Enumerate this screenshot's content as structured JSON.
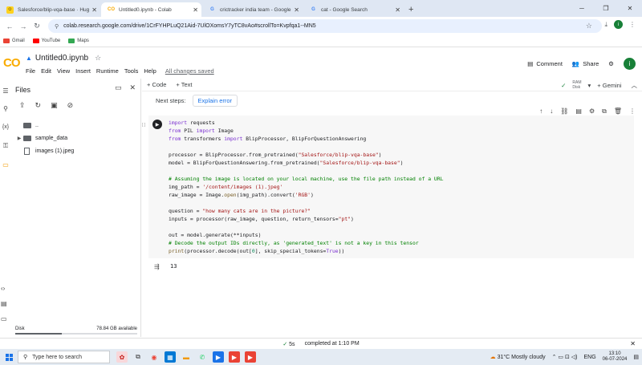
{
  "browser": {
    "tabs": [
      {
        "title": "Salesforce/blip-vqa-base · Hug",
        "icon": "huggingface-icon",
        "active": false
      },
      {
        "title": "Untitled0.ipynb - Colab",
        "icon": "colab-icon",
        "active": true
      },
      {
        "title": "crictracker india team - Google",
        "icon": "google-icon",
        "active": false
      },
      {
        "title": "cat - Google Search",
        "icon": "google-icon",
        "active": false
      }
    ],
    "url": "colab.research.google.com/drive/1CrFYHPLuQ21Aid-7UlOXomsY7yTC8vAo#scrollTo=Kvpfqa1--MN5",
    "bookmarks": [
      {
        "label": "Gmail",
        "color": "#ea4335"
      },
      {
        "label": "YouTube",
        "color": "#ff0000"
      },
      {
        "label": "Maps",
        "color": "#34a853"
      }
    ],
    "profile_initial": "i"
  },
  "colab": {
    "logo": "CO",
    "notebook_title": "Untitled0.ipynb",
    "menu": [
      "File",
      "Edit",
      "View",
      "Insert",
      "Runtime",
      "Tools",
      "Help"
    ],
    "saved_status": "All changes saved",
    "comment_label": "Comment",
    "share_label": "Share",
    "user_initial": "i",
    "toolbar": {
      "add_code": "+ Code",
      "add_text": "+ Text",
      "ram_label": "RAM",
      "disk_label": "Disk",
      "gemini_label": "+ Gemini"
    }
  },
  "files": {
    "title": "Files",
    "tree": [
      {
        "name": "..",
        "type": "folder",
        "caret": ""
      },
      {
        "name": "sample_data",
        "type": "folder",
        "caret": "▶"
      },
      {
        "name": "images (1).jpeg",
        "type": "file",
        "caret": ""
      }
    ],
    "disk_label": "Disk",
    "disk_available": "78.84 GB available",
    "disk_used_fraction": 0.38
  },
  "next_steps": {
    "label": "Next steps:",
    "button": "Explain error"
  },
  "output": {
    "value": "13"
  },
  "status": {
    "elapsed": "5s",
    "message": "completed at 1:10 PM"
  },
  "taskbar": {
    "search_placeholder": "Type here to search",
    "weather": "31°C  Mostly cloudy",
    "lang": "ENG",
    "time": "13:10",
    "date": "06-07-2024"
  }
}
